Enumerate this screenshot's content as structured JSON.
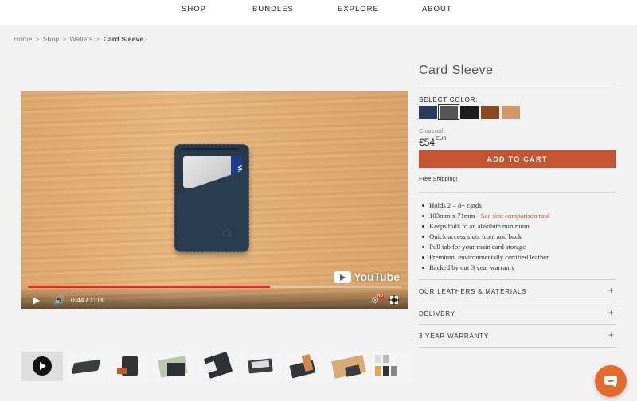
{
  "nav": {
    "items": [
      "SHOP",
      "BUNDLES",
      "EXPLORE",
      "ABOUT"
    ]
  },
  "breadcrumb": {
    "items": [
      "Home",
      "Shop",
      "Wallets"
    ],
    "separator": ">",
    "current": "Card Sleeve"
  },
  "video": {
    "time": "0:44 / 1:08",
    "progress_fraction": 0.648,
    "brand": "YouTube",
    "card_brand": "VISA",
    "hd_badge": "HD"
  },
  "thumbnails": {
    "count": 9,
    "active_index": 0
  },
  "product": {
    "title": "Card Sleeve",
    "select_color_label": "SELECT COLOR:",
    "colors": [
      "#2b3b5e",
      "#555555",
      "#1c1c1c",
      "#8a4a1e",
      "#d09a66"
    ],
    "selected_color_index": 1,
    "color_name": "Charcoal",
    "price": "€54",
    "currency": "EUR",
    "add_to_cart_label": "ADD TO CART",
    "shipping_note": "Free Shipping!",
    "features": [
      "Holds 2 – 8+ cards",
      "103mm x 71mm - ",
      "Keeps bulk to an absolute minimum",
      "Quick access slots front and back",
      "Pull tab for your main card storage",
      "Premium, environmentally certified leather",
      "Backed by our 3 year warranty"
    ],
    "feature_link": "See size comparison tool",
    "accordions": [
      "OUR LEATHERS & MATERIALS",
      "DELIVERY",
      "3 YEAR WARRANTY"
    ],
    "accordion_symbol": "+"
  },
  "colors": {
    "accent": "#c65430",
    "chat": "#e66a2c",
    "youtube_red": "#e52d27"
  }
}
